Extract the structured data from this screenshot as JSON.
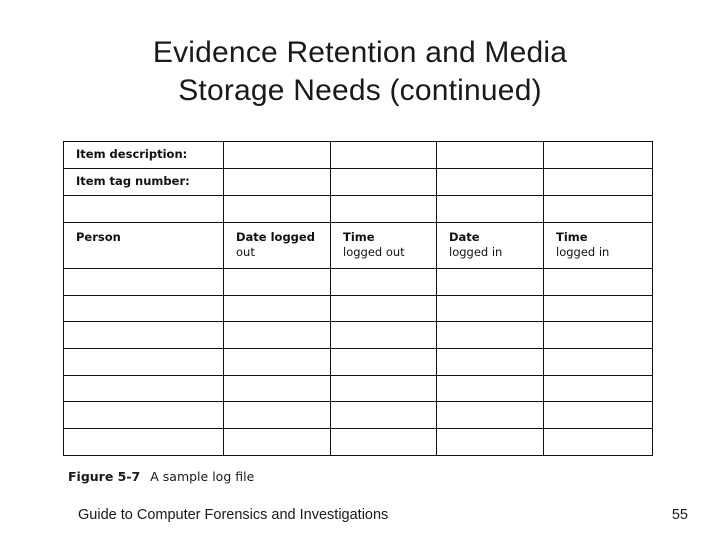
{
  "slide": {
    "title_line1": "Evidence Retention and Media",
    "title_line2": "Storage Needs (continued)"
  },
  "figure": {
    "caption_number": "Figure 5-7",
    "caption_text": "A sample log file",
    "table": {
      "label_rows": [
        {
          "label": "Item description:"
        },
        {
          "label": "Item tag number:"
        },
        {
          "label": ""
        }
      ],
      "header_row": [
        {
          "bold": "Person",
          "rest": ""
        },
        {
          "bold": "Date logged",
          "rest": "out"
        },
        {
          "bold": "Time",
          "rest": "logged out"
        },
        {
          "bold": "Date",
          "rest": "logged in"
        },
        {
          "bold": "Time",
          "rest": "logged in"
        }
      ],
      "body_row_count": 7,
      "column_count": 5
    }
  },
  "footer": {
    "text": "Guide to Computer Forensics and Investigations",
    "page_number": "55"
  }
}
